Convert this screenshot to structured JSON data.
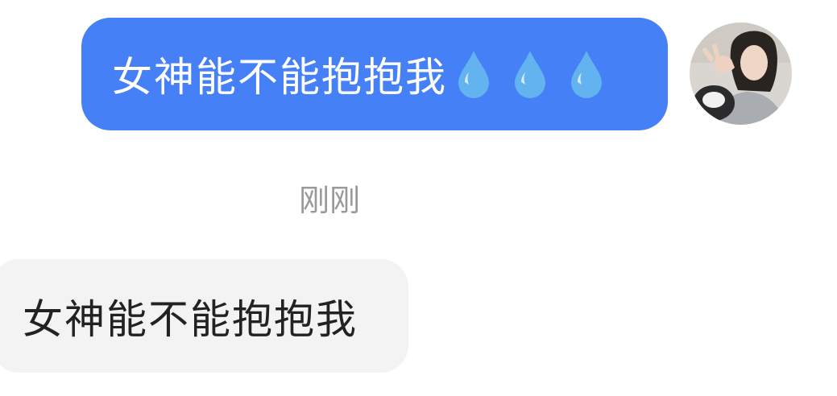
{
  "messages": {
    "sent": {
      "text": "女神能不能抱抱我",
      "emoji": [
        "droplet-icon",
        "droplet-icon",
        "droplet-icon"
      ]
    },
    "timestamp": "刚刚",
    "received": {
      "text": "女神能不能抱抱我"
    }
  },
  "colors": {
    "sent_bubble": "#4680f7",
    "received_bubble": "#f3f3f3",
    "timestamp_text": "#999999",
    "droplet": "#63b3f0"
  }
}
